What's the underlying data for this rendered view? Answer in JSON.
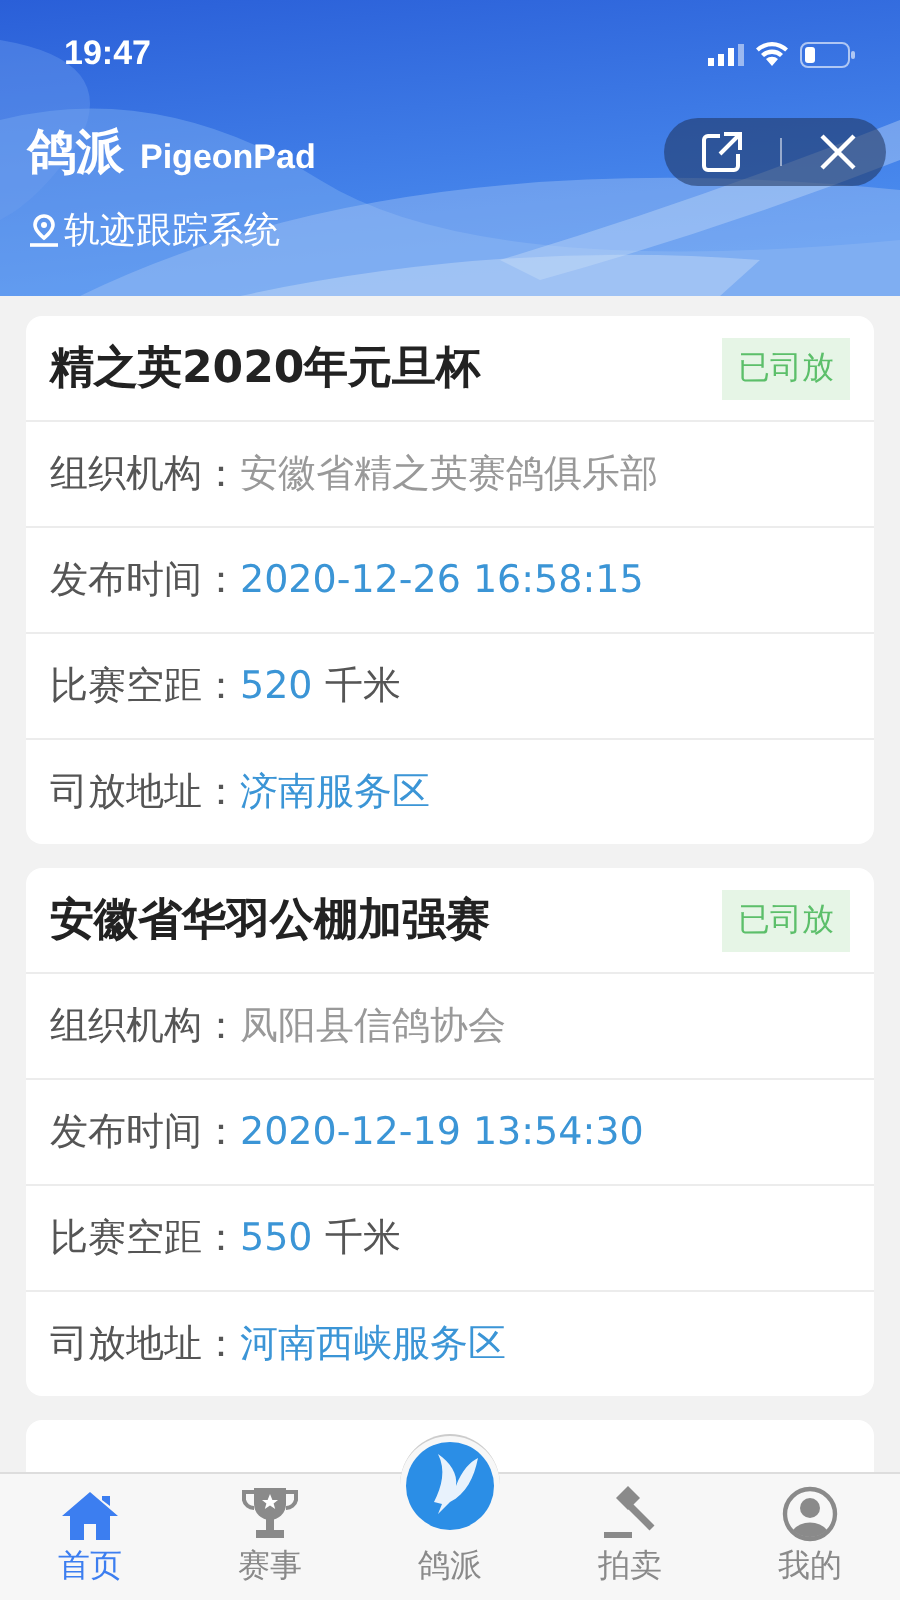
{
  "status_bar": {
    "time": "19:47"
  },
  "header": {
    "app_name": "鸽派",
    "app_name_latin": "PigeonPad",
    "subtitle": "轨迹跟踪系统"
  },
  "races": [
    {
      "title": "精之英2020年元旦杯",
      "status": "已司放",
      "fields": [
        {
          "label": "组织机构：",
          "value": "安徽省精之英赛鸽俱乐部",
          "kind": "plain"
        },
        {
          "label": "发布时间：",
          "value": "2020-12-26 16:58:15",
          "kind": "highlight"
        },
        {
          "label": "比赛空距：",
          "value": "520",
          "unit": "千米",
          "kind": "highlight"
        },
        {
          "label": "司放地址：",
          "value": "济南服务区",
          "kind": "highlight"
        }
      ]
    },
    {
      "title": "安徽省华羽公棚加强赛",
      "status": "已司放",
      "fields": [
        {
          "label": "组织机构：",
          "value": "凤阳县信鸽协会",
          "kind": "plain"
        },
        {
          "label": "发布时间：",
          "value": "2020-12-19 13:54:30",
          "kind": "highlight"
        },
        {
          "label": "比赛空距：",
          "value": "550",
          "unit": "千米",
          "kind": "highlight"
        },
        {
          "label": "司放地址：",
          "value": "河南西峡服务区",
          "kind": "highlight"
        }
      ]
    }
  ],
  "tabs": [
    {
      "label": "首页",
      "kind": "home",
      "selected": true
    },
    {
      "label": "赛事",
      "kind": "trophy",
      "selected": false
    },
    {
      "label": "鸽派",
      "kind": "center",
      "selected": false
    },
    {
      "label": "拍卖",
      "kind": "gavel",
      "selected": false
    },
    {
      "label": "我的",
      "kind": "profile",
      "selected": false
    }
  ]
}
